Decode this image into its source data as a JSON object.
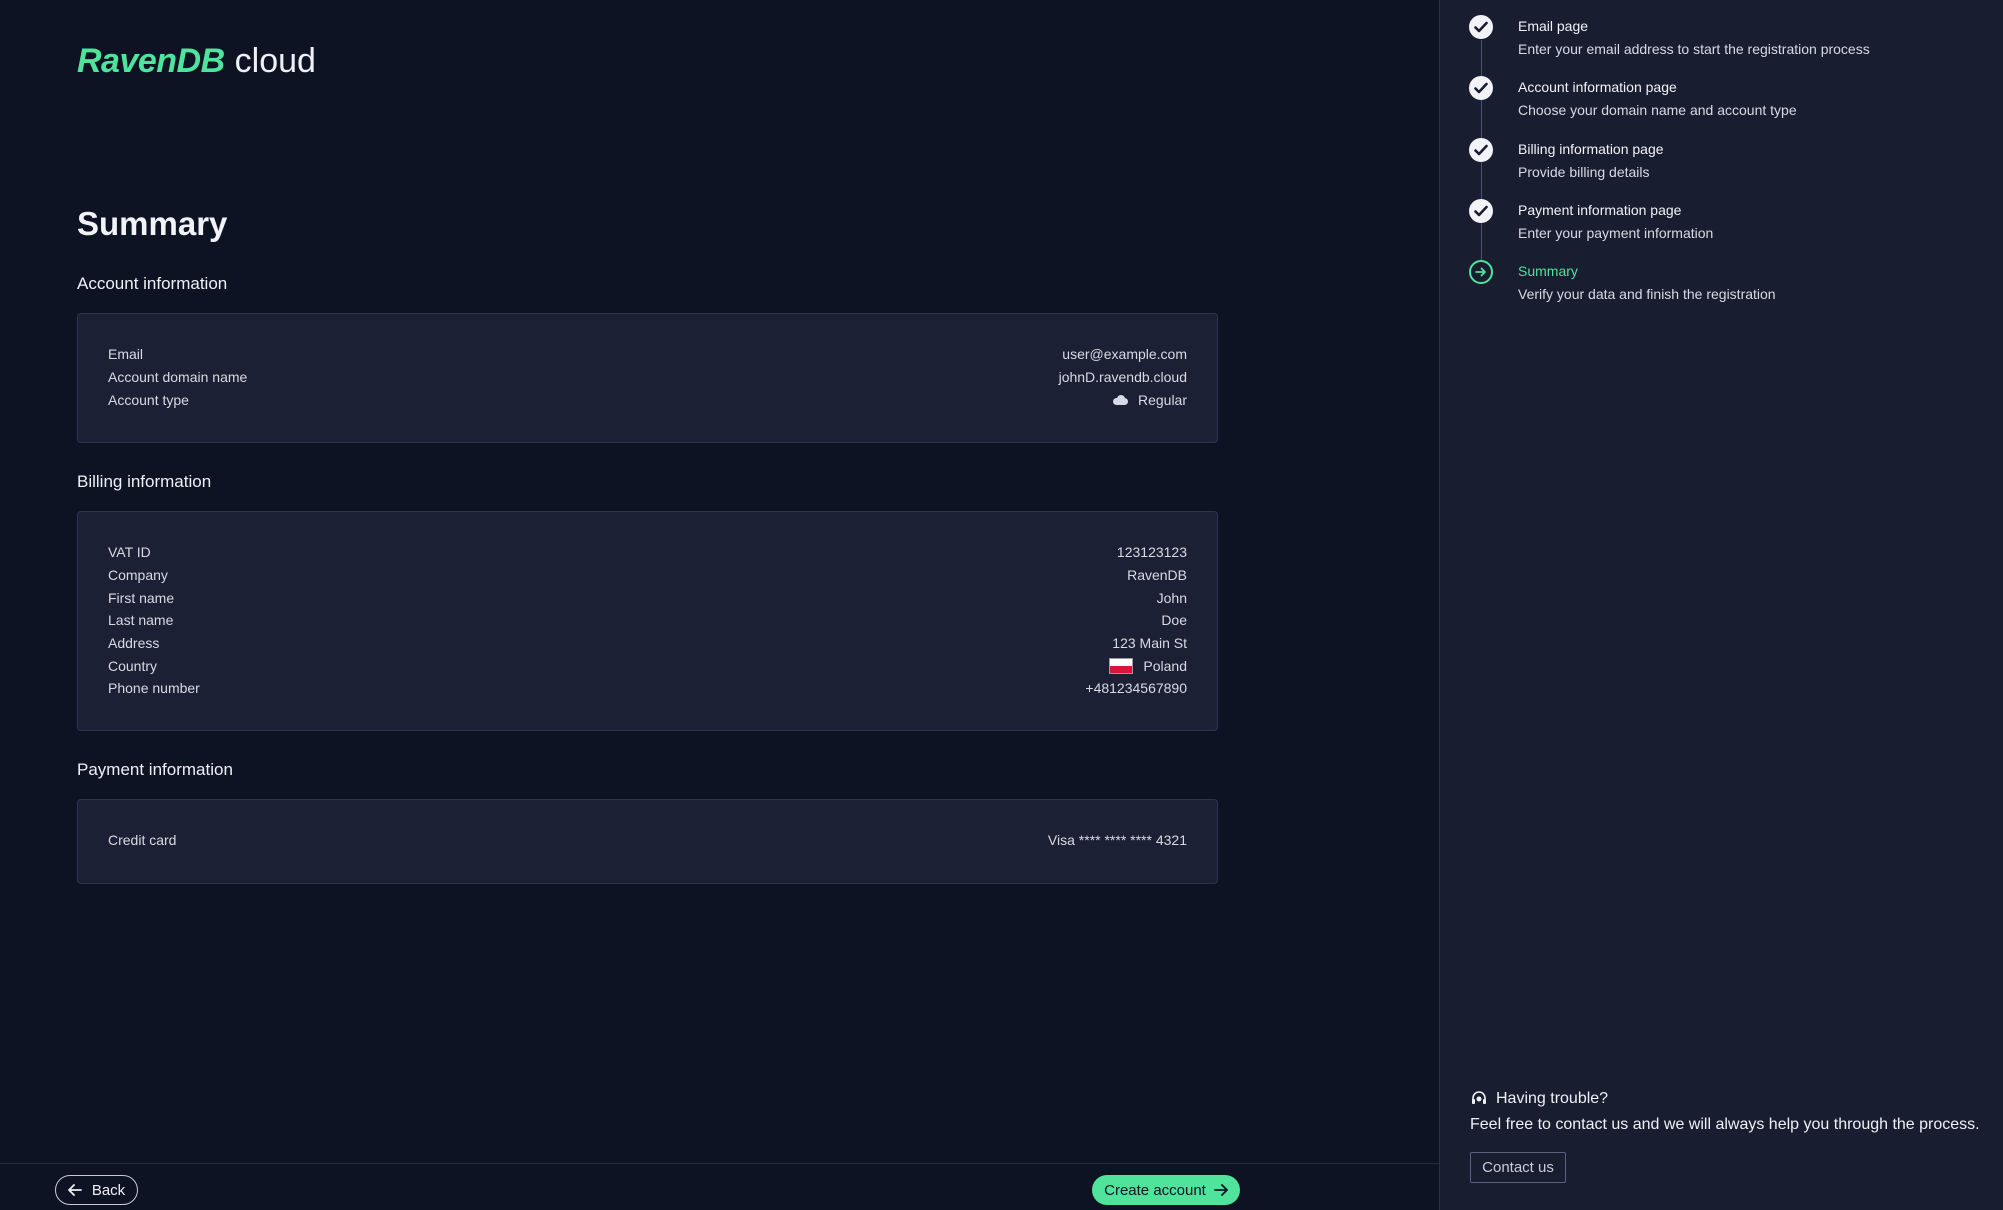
{
  "header": {
    "brand": "RavenDB",
    "product": "cloud"
  },
  "page_title": "Summary",
  "account_section": {
    "title": "Account information",
    "rows": [
      {
        "label": "Email",
        "value": "user@example.com"
      },
      {
        "label": "Account domain name",
        "value": "johnD.ravendb.cloud"
      },
      {
        "label": "Account type",
        "value": "Regular",
        "icon": "cloud-icon"
      }
    ]
  },
  "billing_section": {
    "title": "Billing information",
    "rows": [
      {
        "label": "VAT ID",
        "value": "123123123"
      },
      {
        "label": "Company",
        "value": "RavenDB"
      },
      {
        "label": "First name",
        "value": "John"
      },
      {
        "label": "Last name",
        "value": "Doe"
      },
      {
        "label": "Address",
        "value": "123 Main St"
      },
      {
        "label": "Country",
        "value": "Poland",
        "icon": "flag-poland-icon"
      },
      {
        "label": "Phone number",
        "value": "+481234567890"
      }
    ]
  },
  "payment_section": {
    "title": "Payment information",
    "rows": [
      {
        "label": "Credit card",
        "value": "Visa **** **** **** 4321"
      }
    ]
  },
  "footer": {
    "back_label": "Back",
    "create_label": "Create account"
  },
  "steps": [
    {
      "title": "Email page",
      "desc": "Enter your email address to start the registration process",
      "status": "done"
    },
    {
      "title": "Account information page",
      "desc": "Choose your domain name and account type",
      "status": "done"
    },
    {
      "title": "Billing information page",
      "desc": "Provide billing details",
      "status": "done"
    },
    {
      "title": "Payment information page",
      "desc": "Enter your payment information",
      "status": "done"
    },
    {
      "title": "Summary",
      "desc": "Verify your data and finish the registration",
      "status": "current"
    }
  ],
  "help": {
    "title": "Having trouble?",
    "text": "Feel free to contact us and we will always help you through the process.",
    "contact_label": "Contact us"
  },
  "colors": {
    "accent": "#4fe39c",
    "background": "#0e1324",
    "card": "#1b2034",
    "sidebar": "#191d30"
  }
}
